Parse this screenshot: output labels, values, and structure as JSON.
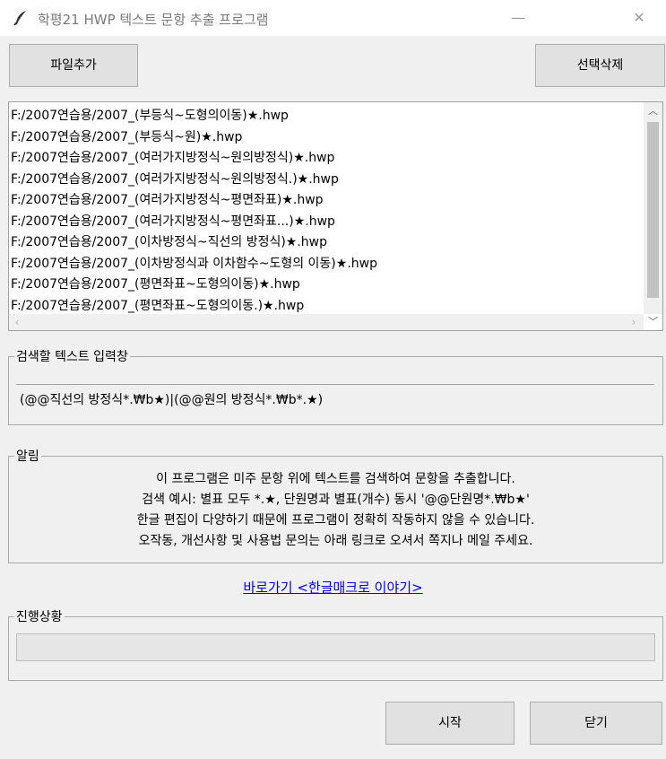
{
  "window": {
    "title": "학평21 HWP 텍스트 문항 추출 프로그램",
    "icon": "feather-icon",
    "minimize_glyph": "—",
    "close_glyph": "✕"
  },
  "toolbar": {
    "add_file_label": "파일추가",
    "delete_selected_label": "선택삭제"
  },
  "file_list": {
    "items": [
      "F:/2007연습용/2007_(부등식~도형의이동)★.hwp",
      "F:/2007연습용/2007_(부등식~원)★.hwp",
      "F:/2007연습용/2007_(여러가지방정식~원의방정식)★.hwp",
      "F:/2007연습용/2007_(여러가지방정식~원의방정식.)★.hwp",
      "F:/2007연습용/2007_(여러가지방정식~평면좌표)★.hwp",
      "F:/2007연습용/2007_(여러가지방정식~평면좌표...)★.hwp",
      "F:/2007연습용/2007_(이차방정식~직선의 방정식)★.hwp",
      "F:/2007연습용/2007_(이차방정식과 이차함수~도형의 이동)★.hwp",
      "F:/2007연습용/2007_(평면좌표~도형의이동)★.hwp",
      "F:/2007연습용/2007_(평면좌표~도형의이동.)★.hwp"
    ]
  },
  "search": {
    "legend": "검색할 텍스트 입력창",
    "value": "(@@직선의 방정식*.₩b★)|(@@원의 방정식*.₩b*.★)"
  },
  "notice": {
    "legend": "알림",
    "lines": [
      "이 프로그램은 미주 문항 위에 텍스트를 검색하여 문항을 추출합니다.",
      "검색 예시: 별표 모두 *.★, 단원명과 별표(개수) 동시 '@@단원명*.₩b★'",
      "한글 편집이 다양하기 때문에 프로그램이 정확히 작동하지 않을 수 있습니다.",
      "오작동, 개선사항 및 사용법 문의는 아래 링크로 오셔서 쪽지나 메일 주세요."
    ]
  },
  "link": {
    "text": "바로가기 <한글매크로 이야기>"
  },
  "progress": {
    "legend": "진행상황",
    "value": 0
  },
  "footer": {
    "start_label": "시작",
    "close_label": "닫기"
  },
  "colors": {
    "background": "#f0f0f0",
    "link": "#0000ee"
  }
}
